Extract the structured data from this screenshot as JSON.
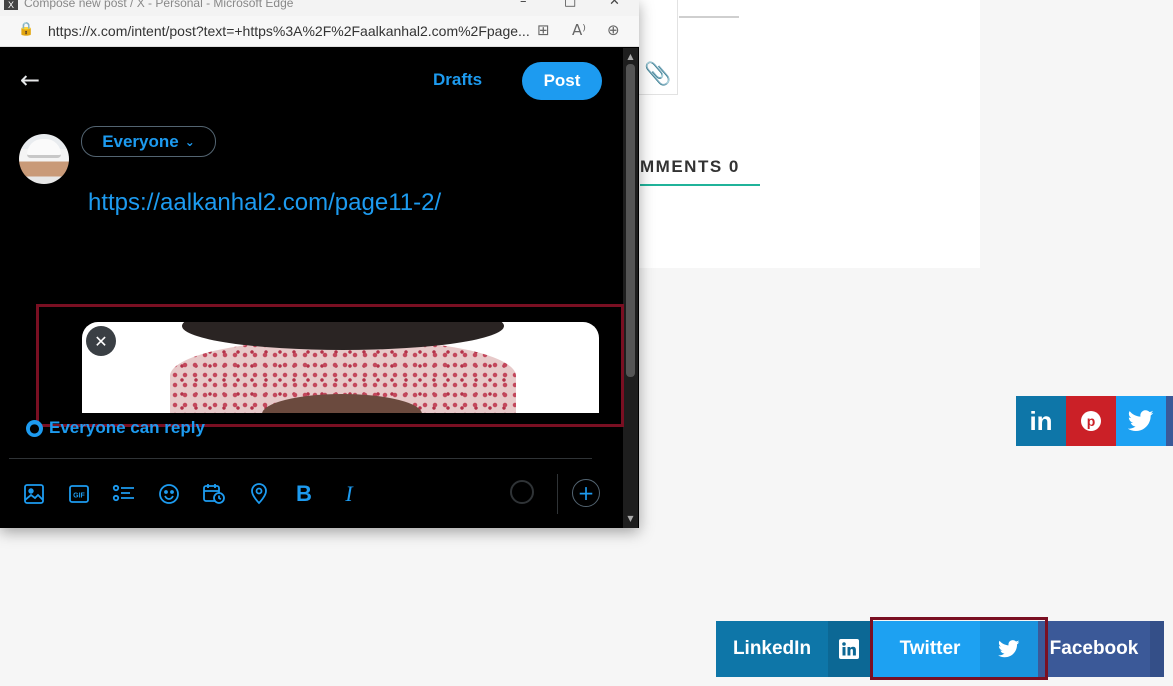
{
  "window": {
    "title": "Compose new post / X - Personal - Microsoft Edge",
    "url": "https://x.com/intent/post?text=+https%3A%2F%2Faalkanhal2.com%2Fpage..."
  },
  "compose": {
    "drafts_label": "Drafts",
    "post_label": "Post",
    "audience_label": "Everyone",
    "text": "https://aalkanhal2.com/page11-2/",
    "reply_setting": "Everyone can reply",
    "colors": {
      "accent": "#1d9bf0",
      "background": "#000000"
    }
  },
  "page": {
    "comments_label": "MMENTS 0",
    "share_buttons": {
      "linkedin": "LinkedIn",
      "twitter": "Twitter",
      "facebook": "Facebook"
    },
    "highlight_color": "#7a0f22"
  },
  "icons": {
    "back": "arrow-left-icon",
    "toolbar": [
      "image-icon",
      "gif-icon",
      "poll-icon",
      "emoji-icon",
      "schedule-icon",
      "location-icon",
      "bold-icon",
      "italic-icon"
    ],
    "floating_share": [
      "linkedin-icon",
      "pinterest-icon",
      "twitter-icon"
    ]
  }
}
